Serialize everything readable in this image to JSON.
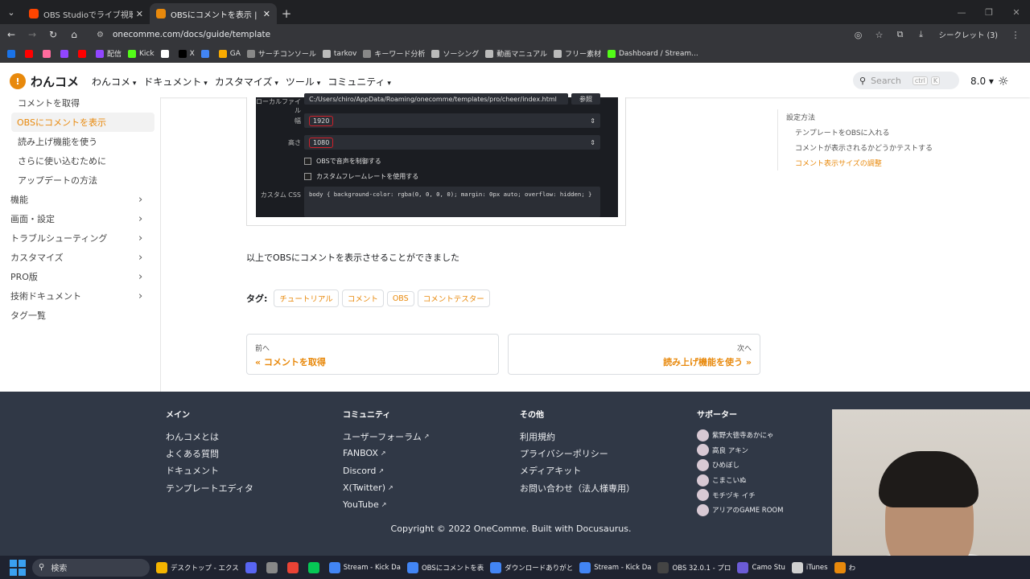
{
  "browser": {
    "tabs": [
      {
        "title": "OBS Studioでライブ視聴者数を確",
        "icon": "reddit-icon",
        "color": "#ff4500"
      },
      {
        "title": "OBSにコメントを表示 | わんコメ - O",
        "icon": "onecomme-icon",
        "color": "#e8890c"
      }
    ],
    "url": "onecomme.com/docs/guide/template",
    "incognito_label": "シークレット (3)",
    "bookmarks": [
      {
        "label": "",
        "color": "#1a73e8"
      },
      {
        "label": "",
        "color": "#ff0000"
      },
      {
        "label": "",
        "color": "#ff6b9d"
      },
      {
        "label": "",
        "color": "#9146ff"
      },
      {
        "label": "",
        "color": "#ff0000"
      },
      {
        "label": "配信",
        "color": "#9146ff"
      },
      {
        "label": "Kick",
        "color": "#53fc18"
      },
      {
        "label": "",
        "color": "#fff"
      },
      {
        "label": "X",
        "color": "#000"
      },
      {
        "label": "",
        "color": "#4285f4"
      },
      {
        "label": "GA",
        "color": "#f9ab00"
      },
      {
        "label": "サーチコンソール",
        "color": "#888"
      },
      {
        "label": "tarkov",
        "color": "#bbb"
      },
      {
        "label": "キーワード分析",
        "color": "#888"
      },
      {
        "label": "ソーシング",
        "color": "#bbb"
      },
      {
        "label": "動画マニュアル",
        "color": "#bbb"
      },
      {
        "label": "フリー素材",
        "color": "#bbb"
      },
      {
        "label": "Dashboard / Stream...",
        "color": "#53fc18"
      }
    ]
  },
  "site": {
    "logo": "わんコメ",
    "nav": [
      "わんコメ",
      "ドキュメント",
      "カスタマイズ",
      "ツール",
      "コミュニティ"
    ],
    "search_placeholder": "Search",
    "search_key1": "ctrl",
    "search_key2": "K",
    "version": "8.0"
  },
  "sidebar": [
    {
      "label": "コメントを取得",
      "type": "sub"
    },
    {
      "label": "OBSにコメントを表示",
      "type": "active"
    },
    {
      "label": "読み上げ機能を使う",
      "type": "sub"
    },
    {
      "label": "さらに使い込むために",
      "type": "sub"
    },
    {
      "label": "アップデートの方法",
      "type": "sub"
    },
    {
      "label": "機能",
      "type": "top",
      "chev": true
    },
    {
      "label": "画面・設定",
      "type": "top",
      "chev": true
    },
    {
      "label": "トラブルシューティング",
      "type": "top",
      "chev": true
    },
    {
      "label": "カスタマイズ",
      "type": "top",
      "chev": true
    },
    {
      "label": "PRO版",
      "type": "top",
      "chev": true
    },
    {
      "label": "技術ドキュメント",
      "type": "top",
      "chev": true
    },
    {
      "label": "タグ一覧",
      "type": "top",
      "chev": false
    }
  ],
  "obs": {
    "local_file_label": "ローカルファイル",
    "local_file_path": "C:/Users/chiro/AppData/Roaming/onecomme/templates/pro/cheer/index.html",
    "browse_label": "参照",
    "width_label": "幅",
    "width_value": "1920",
    "height_label": "高さ",
    "height_value": "1080",
    "check1": "OBSで音声を制御する",
    "check2": "カスタムフレームレートを使用する",
    "css_label": "カスタム CSS",
    "css_value": "body { background-color: rgba(0, 0, 0, 0); margin: 0px auto; overflow: hidden; }"
  },
  "content": {
    "complete_text": "以上でOBSにコメントを表示させることができました",
    "tags_label": "タグ:",
    "tags": [
      "チュートリアル",
      "コメント",
      "OBS",
      "コメントテスター"
    ],
    "prev_sub": "前へ",
    "prev_label": "« コメントを取得",
    "next_sub": "次へ",
    "next_label": "読み上げ機能を使う »"
  },
  "toc": [
    {
      "label": "設定方法",
      "level": 1,
      "active": false
    },
    {
      "label": "テンプレートをOBSに入れる",
      "level": 2,
      "active": false
    },
    {
      "label": "コメントが表示されるかどうかテストする",
      "level": 2,
      "active": false
    },
    {
      "label": "コメント表示サイズの調整",
      "level": 2,
      "active": true
    }
  ],
  "footer": {
    "columns": [
      {
        "title": "メイン",
        "links": [
          {
            "t": "わんコメとは",
            "ext": false
          },
          {
            "t": "よくある質問",
            "ext": false
          },
          {
            "t": "ドキュメント",
            "ext": false
          },
          {
            "t": "テンプレートエディタ",
            "ext": false
          }
        ]
      },
      {
        "title": "コミュニティ",
        "links": [
          {
            "t": "ユーザーフォーラム",
            "ext": true
          },
          {
            "t": "FANBOX",
            "ext": true
          },
          {
            "t": "Discord",
            "ext": true
          },
          {
            "t": "X(Twitter)",
            "ext": true
          },
          {
            "t": "YouTube",
            "ext": true
          }
        ]
      },
      {
        "title": "その他",
        "links": [
          {
            "t": "利用規約",
            "ext": false
          },
          {
            "t": "プライバシーポリシー",
            "ext": false
          },
          {
            "t": "メディアキット",
            "ext": false
          },
          {
            "t": "お問い合わせ（法人様専用）",
            "ext": false
          }
        ]
      }
    ],
    "supporters_title": "サポーター",
    "supporters": [
      "紫野大徳寺あかにゃ",
      "高良 アキン",
      "ひめぼし",
      "こまこいぬ",
      "モチヅキ イチ",
      "アリアのGAME ROOM"
    ],
    "copyright": "Copyright © 2022 OneComme. Built with Docusaurus."
  },
  "taskbar": {
    "search": "検索",
    "apps": [
      {
        "label": "デスクトップ - エクス",
        "color": "#f4b400"
      },
      {
        "label": "",
        "color": "#5865f2"
      },
      {
        "label": "",
        "color": "#888"
      },
      {
        "label": "",
        "color": "#ea4335"
      },
      {
        "label": "",
        "color": "#06c755"
      },
      {
        "label": "Stream - Kick Da",
        "color": "#4285f4"
      },
      {
        "label": "OBSにコメントを表",
        "color": "#4285f4"
      },
      {
        "label": "ダウンロードありがと",
        "color": "#4285f4"
      },
      {
        "label": "Stream - Kick Da",
        "color": "#4285f4"
      },
      {
        "label": "OBS 32.0.1 - プロ",
        "color": "#444"
      },
      {
        "label": "Camo Stu",
        "color": "#6b5bd6"
      },
      {
        "label": "iTunes",
        "color": "#d0d0d0"
      },
      {
        "label": "わ",
        "color": "#e8890c"
      }
    ]
  },
  "colors": {
    "accent": "#e8890c",
    "footer_bg": "#303846"
  }
}
